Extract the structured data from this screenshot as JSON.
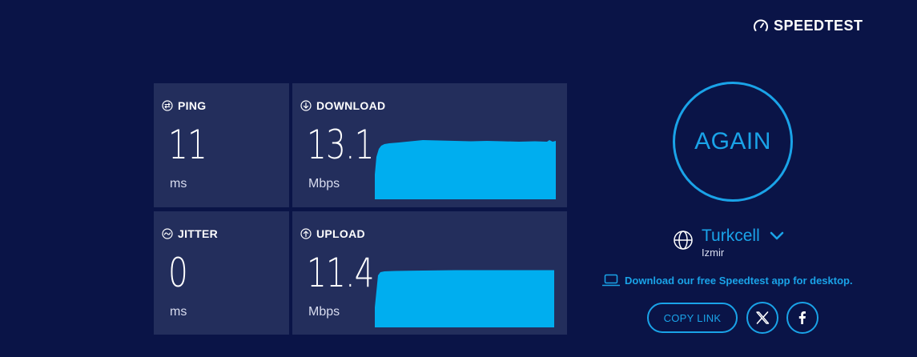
{
  "brand": {
    "logo_text": "SPEEDTEST"
  },
  "results": {
    "ping": {
      "label": "PING",
      "value": "11",
      "unit": "ms",
      "icon": "ping-icon"
    },
    "jitter": {
      "label": "JITTER",
      "value": "0",
      "unit": "ms",
      "icon": "jitter-icon"
    },
    "download": {
      "label": "DOWNLOAD",
      "value": "13.1",
      "unit": "Mbps",
      "icon": "download-arrow-icon"
    },
    "upload": {
      "label": "UPLOAD",
      "value": "11.4",
      "unit": "Mbps",
      "icon": "upload-arrow-icon"
    }
  },
  "actions": {
    "again_label": "AGAIN",
    "copy_link_label": "COPY LINK",
    "desktop_app_text": "Download our free Speedtest app for desktop."
  },
  "provider": {
    "name": "Turkcell",
    "location": "Izmir"
  },
  "share": [
    "x-logo-icon",
    "facebook-icon"
  ],
  "colors": {
    "background": "#0a1447",
    "tile": "#232e5c",
    "accent": "#1aa3e8",
    "graph_fill": "#00aeef"
  }
}
